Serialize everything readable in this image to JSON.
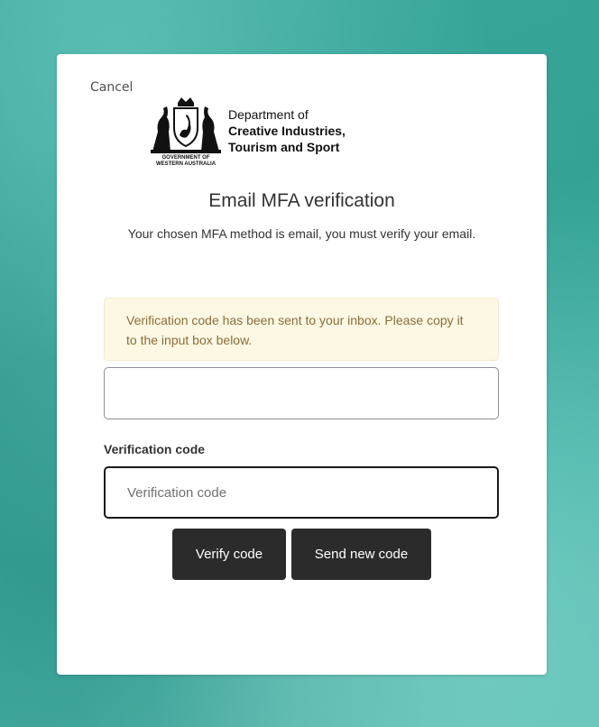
{
  "colors": {
    "background": "#3aa79d",
    "card": "#ffffff",
    "alert_bg": "#fcf8e3",
    "alert_text": "#8a6d3b",
    "button_bg": "#2b2b2b",
    "button_text": "#ffffff"
  },
  "header": {
    "cancel_label": "Cancel"
  },
  "logo": {
    "crest_icon": "wa-government-crest-icon",
    "crest_caption_line1": "GOVERNMENT OF",
    "crest_caption_line2": "WESTERN AUSTRALIA",
    "dept_line1": "Department of",
    "dept_line2": "Creative Industries,",
    "dept_line3": "Tourism and Sport"
  },
  "main": {
    "title": "Email MFA verification",
    "subtitle": "Your chosen MFA method is email, you must verify your email.",
    "alert": "Verification code has been sent to your inbox. Please copy it to the input box below.",
    "email_value": "",
    "code_label": "Verification code",
    "code_placeholder": "Verification code",
    "code_value": ""
  },
  "buttons": {
    "verify_label": "Verify code",
    "send_new_label": "Send new code"
  }
}
